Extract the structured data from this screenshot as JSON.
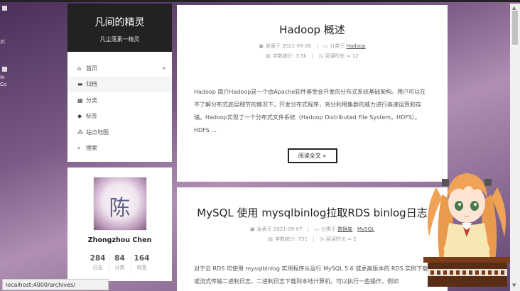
{
  "site": {
    "title": "凡间的精灵",
    "subtitle": "凡尘落素一精灵"
  },
  "menu": [
    {
      "icon": "⌂",
      "label": "首页"
    },
    {
      "icon": "▬",
      "label": "归档"
    },
    {
      "icon": "▦",
      "label": "分类"
    },
    {
      "icon": "◆",
      "label": "标签"
    },
    {
      "icon": "⁂",
      "label": "站点地图"
    },
    {
      "icon": "⌕",
      "label": "搜索"
    }
  ],
  "profile": {
    "avatar_text": "陈",
    "name": "Zhongzhou Chen",
    "stats": [
      {
        "num": "284",
        "label": "日志"
      },
      {
        "num": "84",
        "label": "分类"
      },
      {
        "num": "164",
        "label": "标签"
      }
    ]
  },
  "posts": [
    {
      "title": "Hadoop 概述",
      "posted_label": "发表于",
      "date": "2021-09-26",
      "category_label": "分类于",
      "categories": [
        "Hadoop"
      ],
      "wordcount_label": "字数统计: 3.5k",
      "readtime_label": "阅读时长 ≈ 12",
      "excerpt": "Hadoop 简介Hadoop是一个由Apache软件基金会开发的分布式系统基础架构。用户可以在不了解分布式底层细节的情况下，开发分布式程序，充分利用集群的威力进行高速运算和存储。Hadoop实现了一个分布式文件系统（Hadoop Distributed File System，HDFS）。HDFS ...",
      "readmore": "阅读全文 »"
    },
    {
      "title": "MySQL 使用 mysqlbinlog拉取RDS binlog日志",
      "posted_label": "发表于",
      "date": "2021-09-07",
      "category_label": "分类于",
      "categories": [
        "数据库",
        "MySQL"
      ],
      "wordcount_label": "字数统计: 751",
      "readtime_label": "阅读时长 ≈ 2",
      "excerpt": "对于云 RDS 可使用 mysqlbinlog 实用程序从运行 MySQL 5.6 或更高版本的 RDS 实例下载或流式传输二进制日志，二进制日志下载到本地计算机，可以执行一些操作，例如"
    }
  ],
  "statusbar": "localhost:4000/archives/",
  "desktop_fragments": [
    "2(",
    "In",
    "Co"
  ]
}
